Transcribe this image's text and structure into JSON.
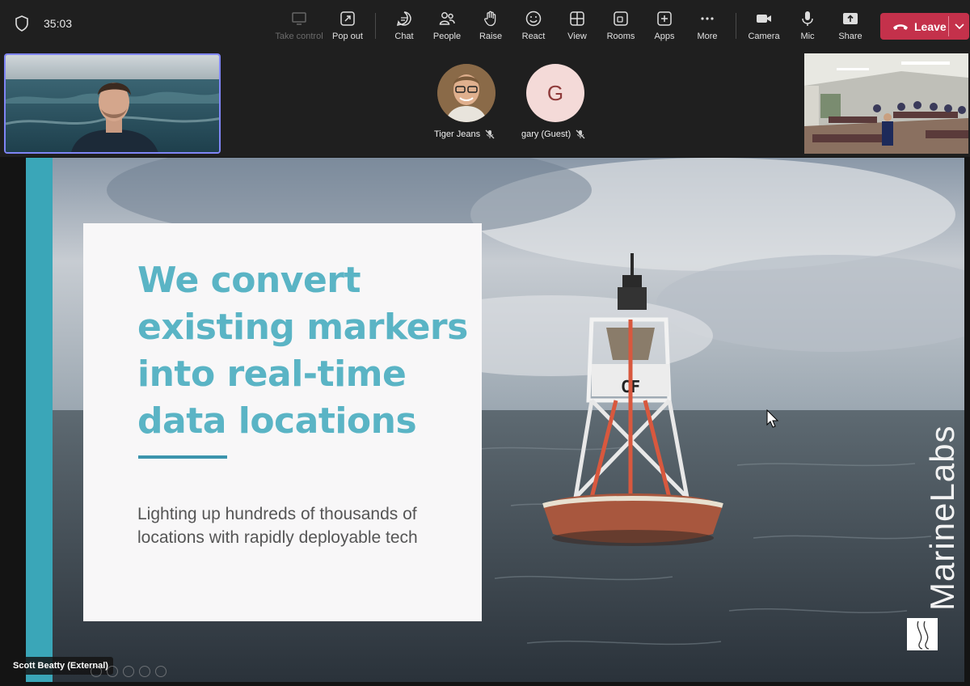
{
  "meeting": {
    "timer": "35:03"
  },
  "toolbar": {
    "take_control": "Take control",
    "pop_out": "Pop out",
    "chat": "Chat",
    "people": "People",
    "raise": "Raise",
    "react": "React",
    "view": "View",
    "rooms": "Rooms",
    "apps": "Apps",
    "more": "More",
    "camera": "Camera",
    "mic": "Mic",
    "share": "Share",
    "leave": "Leave"
  },
  "participants": [
    {
      "name": "Tiger Jeans",
      "muted": true
    },
    {
      "name": "gary (Guest)",
      "initial": "G",
      "muted": true
    }
  ],
  "slide": {
    "headline": "We convert existing markers into real-time data locations",
    "subtext": "Lighting up hundreds of thousands of locations with rapidly deployable tech",
    "brand": "MarineLabs",
    "buoy_label": "CF"
  },
  "presenter": {
    "label": "Scott Beatty (External)"
  },
  "colors": {
    "accent": "#7f85f5",
    "leave": "#c4314b",
    "teal": "#5ab4c5",
    "teal_bar": "#3aa6b8"
  }
}
